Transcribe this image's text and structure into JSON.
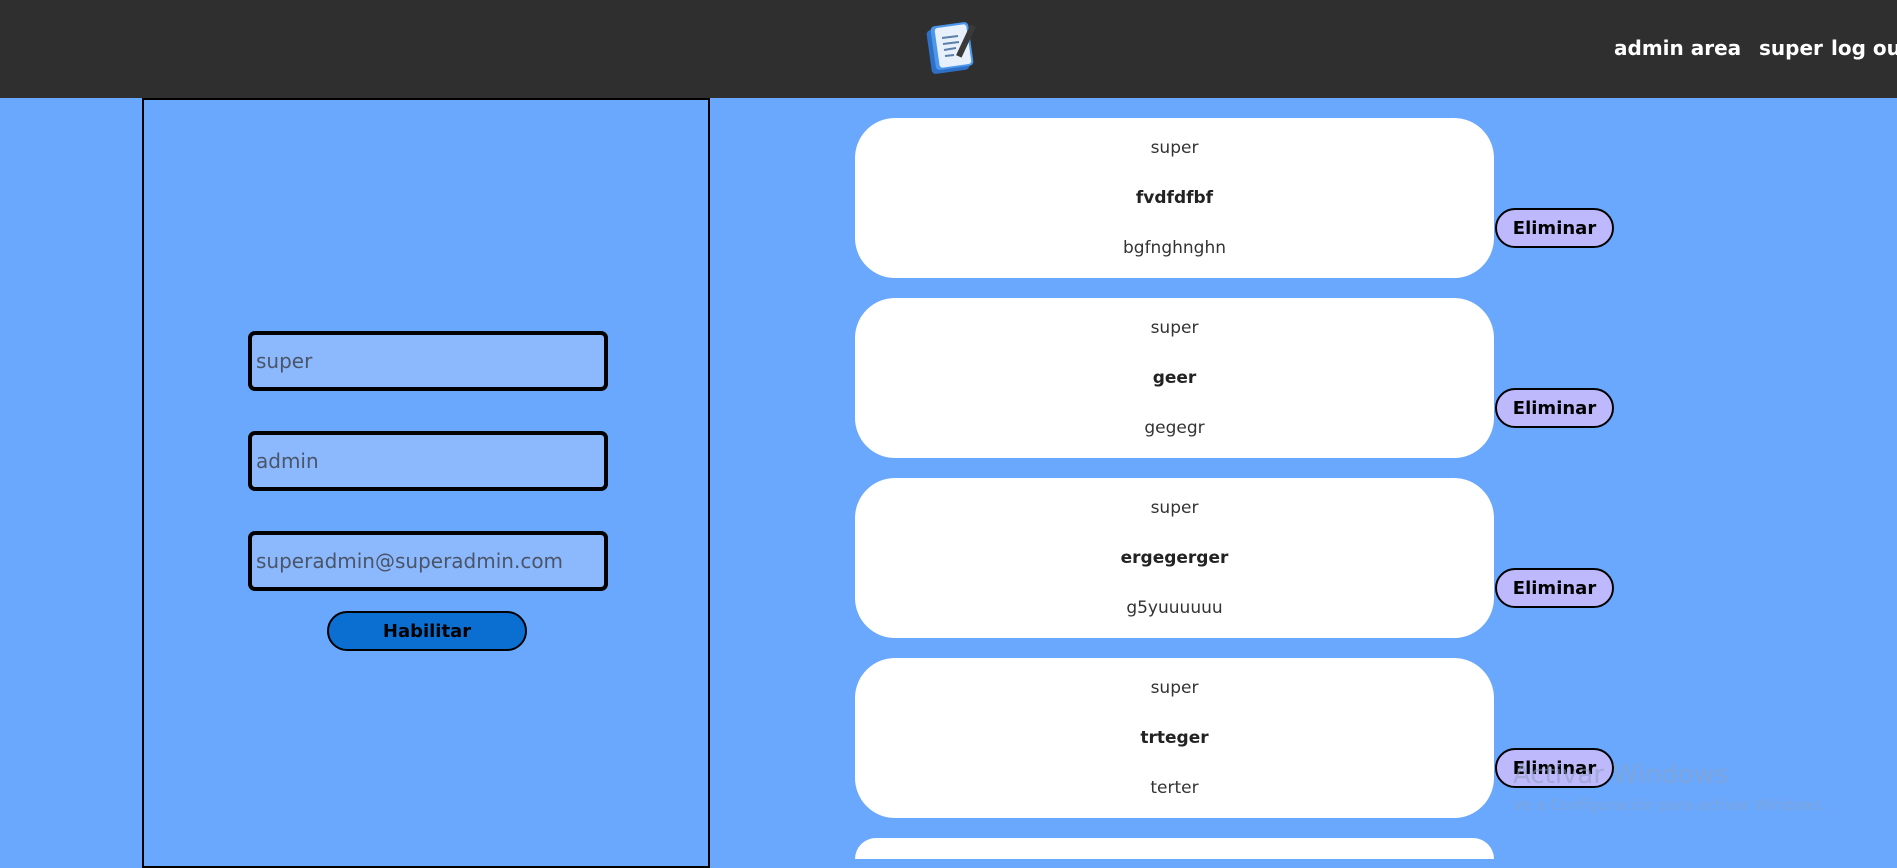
{
  "header": {
    "logo_icon": "notepad-pen-icon",
    "nav": {
      "admin_area": "admin area",
      "user": "super",
      "logout": "log out"
    }
  },
  "form": {
    "fields": [
      {
        "placeholder": "super"
      },
      {
        "placeholder": "admin"
      },
      {
        "placeholder": "superadmin@superadmin.com"
      }
    ],
    "submit_label": "Habilitar"
  },
  "posts": [
    {
      "author": "super",
      "title": "fvdfdfbf",
      "body": "bgfnghnghn",
      "delete_label": "Eliminar"
    },
    {
      "author": "super",
      "title": "geer",
      "body": "gegegr",
      "delete_label": "Eliminar"
    },
    {
      "author": "super",
      "title": "ergegerger",
      "body": "g5yuuuuuu",
      "delete_label": "Eliminar"
    },
    {
      "author": "super",
      "title": "trteger",
      "body": "terter",
      "delete_label": "Eliminar"
    }
  ],
  "watermark": {
    "line1": "Activar Windows",
    "line2": "Ve a Configuración para activar Windows."
  },
  "colors": {
    "background": "#6aa8fe",
    "topbar": "#2f2f2f",
    "input_bg": "#8cb8fd",
    "primary_button": "#0b6fd2",
    "delete_button": "#bdb9fc"
  }
}
